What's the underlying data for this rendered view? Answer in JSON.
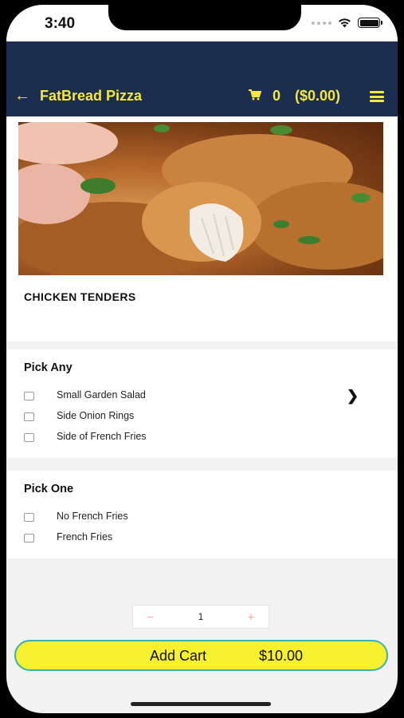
{
  "status_bar": {
    "time": "3:40"
  },
  "header": {
    "back_icon": "arrow-left-icon",
    "title": "FatBread Pizza",
    "cart_icon": "cart-icon",
    "cart_count": "0",
    "cart_total": "($0.00)",
    "menu_icon": "hamburger-menu-icon",
    "accent_color": "#f6e83a",
    "bar_color": "#1c2e4f"
  },
  "item": {
    "name": "CHICKEN TENDERS",
    "image": "fried-chicken-tenders-photo"
  },
  "groups": [
    {
      "title": "Pick Any",
      "options": [
        {
          "label": "Small Garden Salad",
          "checked": false
        },
        {
          "label": "Side Onion Rings",
          "checked": false
        },
        {
          "label": "Side of French Fries",
          "checked": false
        }
      ]
    },
    {
      "title": "Pick One",
      "options": [
        {
          "label": "No French Fries",
          "checked": false
        },
        {
          "label": "French Fries",
          "checked": false
        }
      ]
    }
  ],
  "quantity": {
    "minus": "−",
    "value": "1",
    "plus": "+"
  },
  "add_cart": {
    "label": "Add Cart",
    "price": "$10.00",
    "color": "#f7f02f"
  }
}
